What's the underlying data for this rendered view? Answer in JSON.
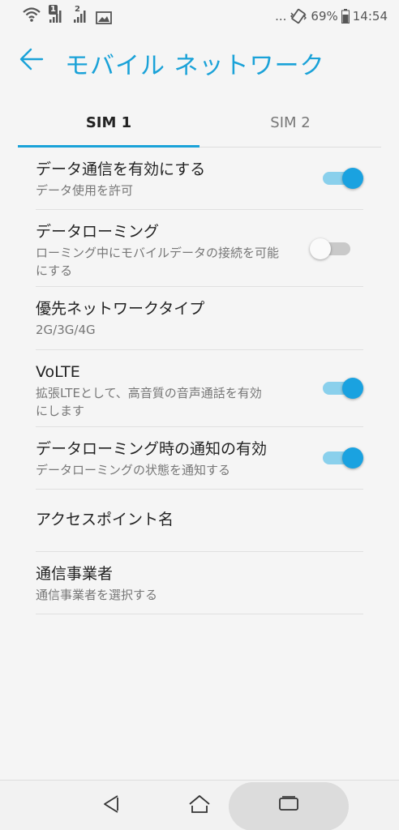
{
  "status_bar": {
    "sim1_badge": "1",
    "sim2_badge": "2",
    "dots": "...",
    "battery": "69%",
    "time": "14:54"
  },
  "app_bar": {
    "title": "モバイル ネットワーク"
  },
  "tabs": [
    {
      "label": "SIM 1",
      "active": true
    },
    {
      "label": "SIM 2",
      "active": false
    }
  ],
  "settings": [
    {
      "title": "データ通信を有効にする",
      "subtitle": "データ使用を許可",
      "toggle": true
    },
    {
      "title": "データローミング",
      "subtitle": "ローミング中にモバイルデータの接続を可能にする",
      "toggle": false
    },
    {
      "title": "優先ネットワークタイプ",
      "subtitle": "2G/3G/4G"
    },
    {
      "title": "VoLTE",
      "subtitle": "拡張LTEとして、高音質の音声通話を有効にします",
      "toggle": true
    },
    {
      "title": "データローミング時の通知の有効",
      "subtitle": "データローミングの状態を通知する",
      "toggle": true
    },
    {
      "title": "アクセスポイント名",
      "subtitle": ""
    },
    {
      "title": "通信事業者",
      "subtitle": "通信事業者を選択する"
    }
  ],
  "colors": {
    "accent": "#1aa2d8",
    "toggle_on_knob": "#1aa2e0",
    "toggle_on_track": "#8ad0ec",
    "toggle_off_track": "#c9c9c9"
  },
  "icons": {
    "back": "arrow-left-icon",
    "wifi": "wifi-icon",
    "signal": "signal-icon",
    "image": "image-icon",
    "vibrate": "vibrate-icon",
    "battery": "battery-icon",
    "nav_back": "triangle-back-icon",
    "nav_home": "home-icon",
    "nav_recents": "recents-icon"
  }
}
